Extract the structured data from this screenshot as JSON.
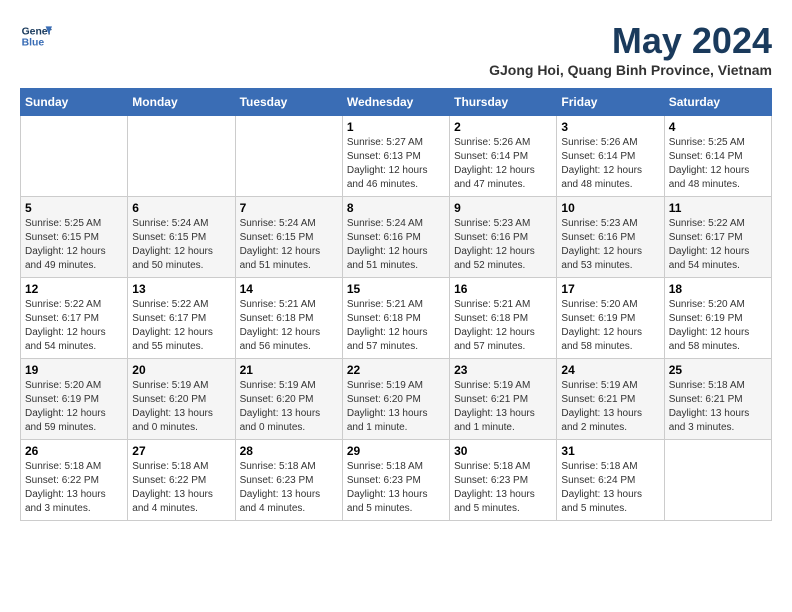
{
  "header": {
    "logo_line1": "General",
    "logo_line2": "Blue",
    "month_year": "May 2024",
    "location": "GJong Hoi, Quang Binh Province, Vietnam"
  },
  "weekdays": [
    "Sunday",
    "Monday",
    "Tuesday",
    "Wednesday",
    "Thursday",
    "Friday",
    "Saturday"
  ],
  "weeks": [
    [
      {
        "day": "",
        "info": ""
      },
      {
        "day": "",
        "info": ""
      },
      {
        "day": "",
        "info": ""
      },
      {
        "day": "1",
        "info": "Sunrise: 5:27 AM\nSunset: 6:13 PM\nDaylight: 12 hours\nand 46 minutes."
      },
      {
        "day": "2",
        "info": "Sunrise: 5:26 AM\nSunset: 6:14 PM\nDaylight: 12 hours\nand 47 minutes."
      },
      {
        "day": "3",
        "info": "Sunrise: 5:26 AM\nSunset: 6:14 PM\nDaylight: 12 hours\nand 48 minutes."
      },
      {
        "day": "4",
        "info": "Sunrise: 5:25 AM\nSunset: 6:14 PM\nDaylight: 12 hours\nand 48 minutes."
      }
    ],
    [
      {
        "day": "5",
        "info": "Sunrise: 5:25 AM\nSunset: 6:15 PM\nDaylight: 12 hours\nand 49 minutes."
      },
      {
        "day": "6",
        "info": "Sunrise: 5:24 AM\nSunset: 6:15 PM\nDaylight: 12 hours\nand 50 minutes."
      },
      {
        "day": "7",
        "info": "Sunrise: 5:24 AM\nSunset: 6:15 PM\nDaylight: 12 hours\nand 51 minutes."
      },
      {
        "day": "8",
        "info": "Sunrise: 5:24 AM\nSunset: 6:16 PM\nDaylight: 12 hours\nand 51 minutes."
      },
      {
        "day": "9",
        "info": "Sunrise: 5:23 AM\nSunset: 6:16 PM\nDaylight: 12 hours\nand 52 minutes."
      },
      {
        "day": "10",
        "info": "Sunrise: 5:23 AM\nSunset: 6:16 PM\nDaylight: 12 hours\nand 53 minutes."
      },
      {
        "day": "11",
        "info": "Sunrise: 5:22 AM\nSunset: 6:17 PM\nDaylight: 12 hours\nand 54 minutes."
      }
    ],
    [
      {
        "day": "12",
        "info": "Sunrise: 5:22 AM\nSunset: 6:17 PM\nDaylight: 12 hours\nand 54 minutes."
      },
      {
        "day": "13",
        "info": "Sunrise: 5:22 AM\nSunset: 6:17 PM\nDaylight: 12 hours\nand 55 minutes."
      },
      {
        "day": "14",
        "info": "Sunrise: 5:21 AM\nSunset: 6:18 PM\nDaylight: 12 hours\nand 56 minutes."
      },
      {
        "day": "15",
        "info": "Sunrise: 5:21 AM\nSunset: 6:18 PM\nDaylight: 12 hours\nand 57 minutes."
      },
      {
        "day": "16",
        "info": "Sunrise: 5:21 AM\nSunset: 6:18 PM\nDaylight: 12 hours\nand 57 minutes."
      },
      {
        "day": "17",
        "info": "Sunrise: 5:20 AM\nSunset: 6:19 PM\nDaylight: 12 hours\nand 58 minutes."
      },
      {
        "day": "18",
        "info": "Sunrise: 5:20 AM\nSunset: 6:19 PM\nDaylight: 12 hours\nand 58 minutes."
      }
    ],
    [
      {
        "day": "19",
        "info": "Sunrise: 5:20 AM\nSunset: 6:19 PM\nDaylight: 12 hours\nand 59 minutes."
      },
      {
        "day": "20",
        "info": "Sunrise: 5:19 AM\nSunset: 6:20 PM\nDaylight: 13 hours\nand 0 minutes."
      },
      {
        "day": "21",
        "info": "Sunrise: 5:19 AM\nSunset: 6:20 PM\nDaylight: 13 hours\nand 0 minutes."
      },
      {
        "day": "22",
        "info": "Sunrise: 5:19 AM\nSunset: 6:20 PM\nDaylight: 13 hours\nand 1 minute."
      },
      {
        "day": "23",
        "info": "Sunrise: 5:19 AM\nSunset: 6:21 PM\nDaylight: 13 hours\nand 1 minute."
      },
      {
        "day": "24",
        "info": "Sunrise: 5:19 AM\nSunset: 6:21 PM\nDaylight: 13 hours\nand 2 minutes."
      },
      {
        "day": "25",
        "info": "Sunrise: 5:18 AM\nSunset: 6:21 PM\nDaylight: 13 hours\nand 3 minutes."
      }
    ],
    [
      {
        "day": "26",
        "info": "Sunrise: 5:18 AM\nSunset: 6:22 PM\nDaylight: 13 hours\nand 3 minutes."
      },
      {
        "day": "27",
        "info": "Sunrise: 5:18 AM\nSunset: 6:22 PM\nDaylight: 13 hours\nand 4 minutes."
      },
      {
        "day": "28",
        "info": "Sunrise: 5:18 AM\nSunset: 6:23 PM\nDaylight: 13 hours\nand 4 minutes."
      },
      {
        "day": "29",
        "info": "Sunrise: 5:18 AM\nSunset: 6:23 PM\nDaylight: 13 hours\nand 5 minutes."
      },
      {
        "day": "30",
        "info": "Sunrise: 5:18 AM\nSunset: 6:23 PM\nDaylight: 13 hours\nand 5 minutes."
      },
      {
        "day": "31",
        "info": "Sunrise: 5:18 AM\nSunset: 6:24 PM\nDaylight: 13 hours\nand 5 minutes."
      },
      {
        "day": "",
        "info": ""
      }
    ]
  ]
}
